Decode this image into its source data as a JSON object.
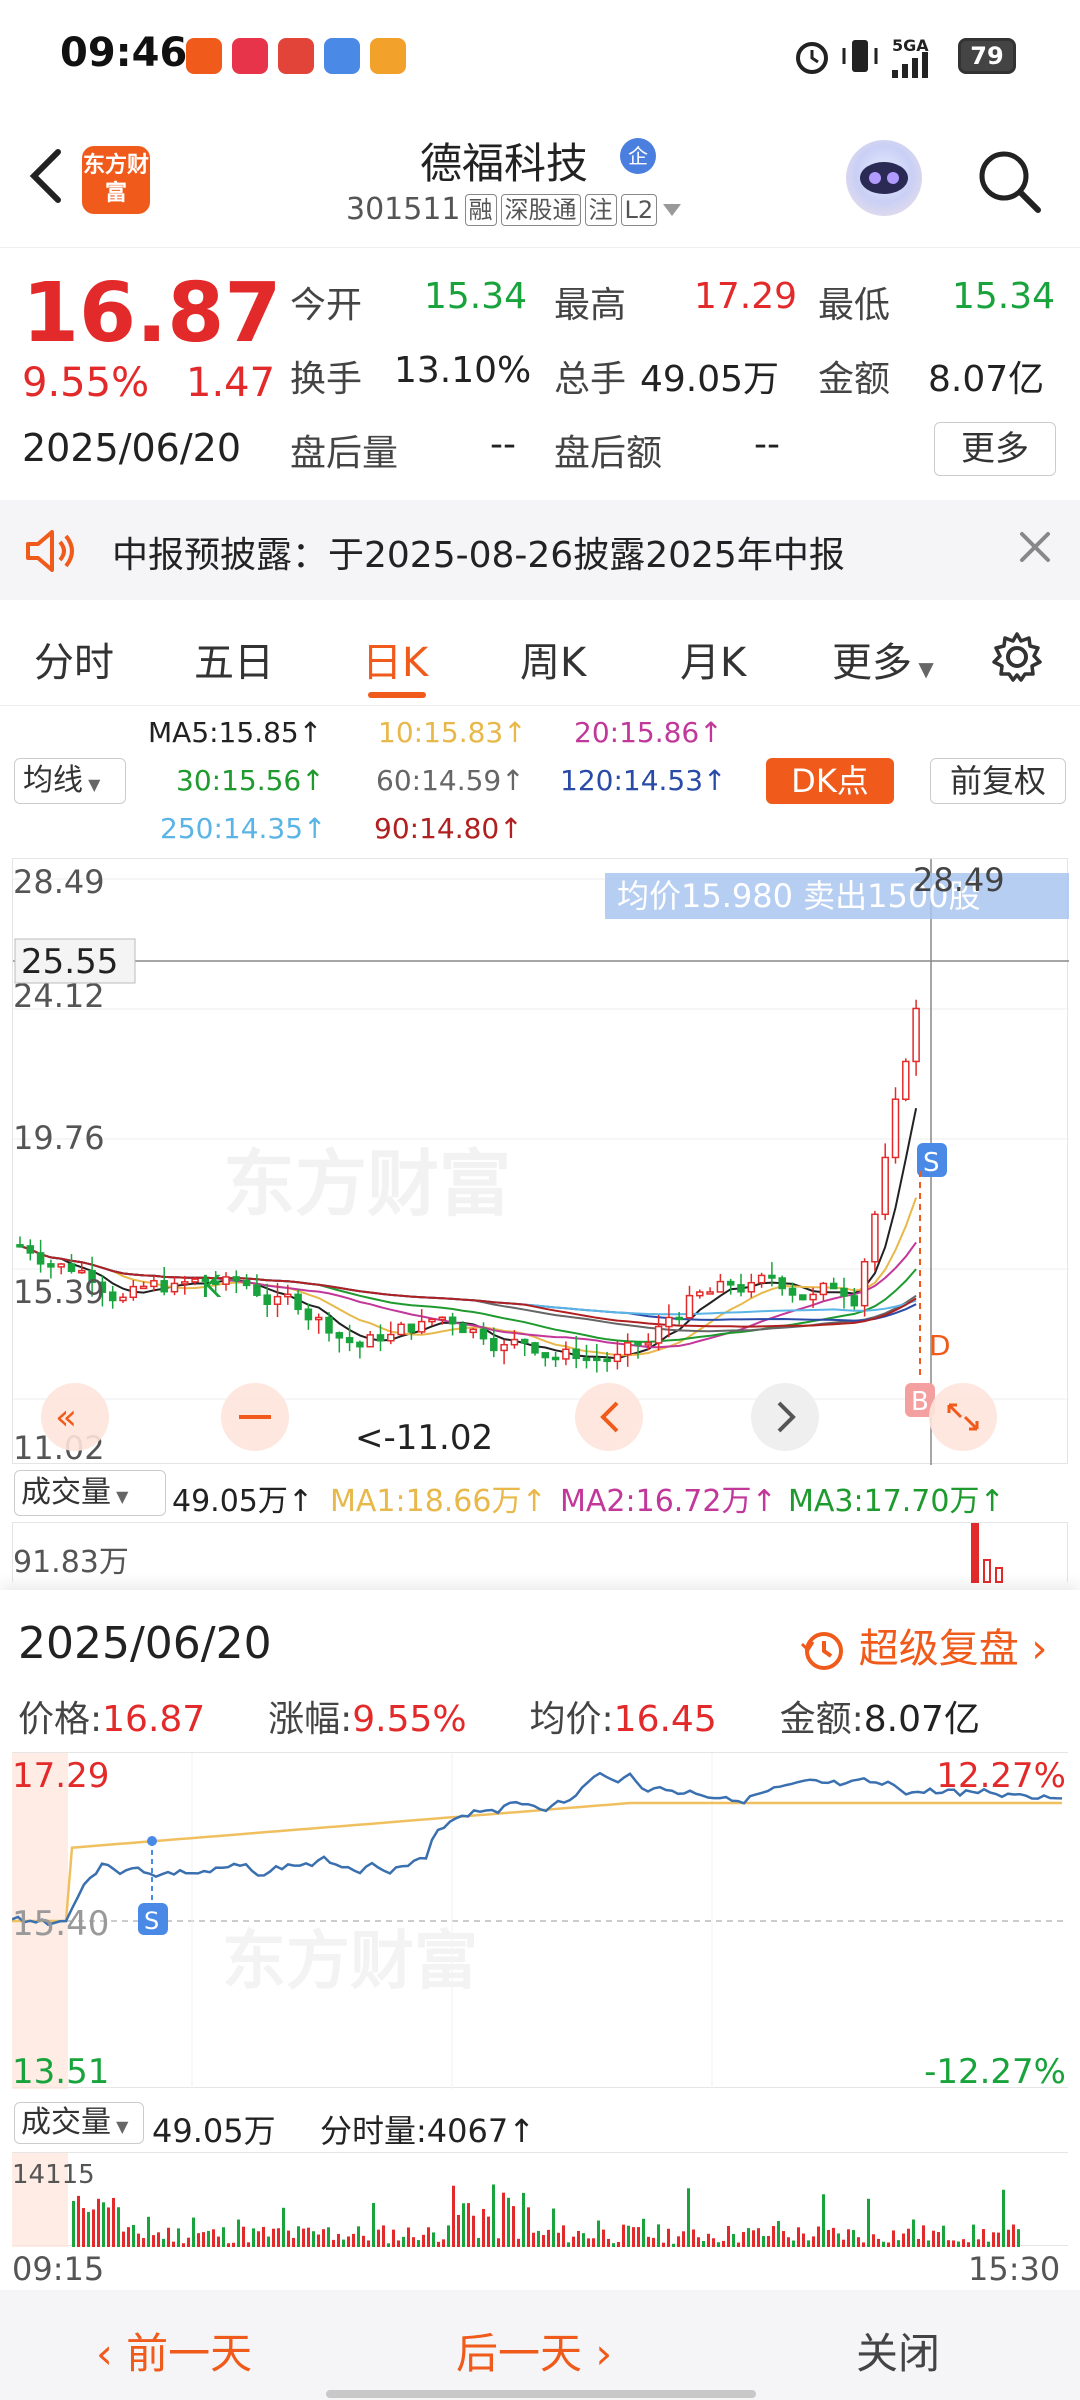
{
  "status_bar": {
    "time": "09:46",
    "network": "5GA",
    "battery": "79"
  },
  "header": {
    "stock_name": "德福科技",
    "ent_badge": "企",
    "logo_text": "东方财富",
    "stock_code": "301511",
    "tags": [
      "融",
      "深股通",
      "注",
      "L2"
    ]
  },
  "quote": {
    "price": "16.87",
    "change_pct": "9.55%",
    "change": "1.47",
    "date": "2025/06/20",
    "fields": [
      {
        "label": "今开",
        "value": "15.34",
        "color": "green"
      },
      {
        "label": "最高",
        "value": "17.29",
        "color": "red"
      },
      {
        "label": "最低",
        "value": "15.34",
        "color": "green"
      },
      {
        "label": "换手",
        "value": "13.10%",
        "color": "black"
      },
      {
        "label": "总手",
        "value": "49.05万",
        "color": "black"
      },
      {
        "label": "金额",
        "value": "8.07亿",
        "color": "black"
      },
      {
        "label": "盘后量",
        "value": "--",
        "color": "black"
      },
      {
        "label": "盘后额",
        "value": "--",
        "color": "black"
      }
    ],
    "more_label": "更多"
  },
  "notice": {
    "text": "中报预披露：于2025-08-26披露2025年中报"
  },
  "tabs": [
    "分时",
    "五日",
    "日K",
    "周K",
    "月K",
    "更多"
  ],
  "active_tab": "日K",
  "ma_legend": {
    "select_label": "均线",
    "items": [
      {
        "text": "MA5:15.85↑",
        "color": "#222222"
      },
      {
        "text": "10:15.83↑",
        "color": "#e8b84a"
      },
      {
        "text": "20:15.86↑",
        "color": "#c2379a"
      },
      {
        "text": "30:15.56↑",
        "color": "#1e9a2e"
      },
      {
        "text": "60:14.59↑",
        "color": "#666666"
      },
      {
        "text": "120:14.53↑",
        "color": "#2a4aa8"
      },
      {
        "text": "250:14.35↑",
        "color": "#5ab4e6"
      },
      {
        "text": "90:14.80↑",
        "color": "#b02020"
      }
    ],
    "dk_label": "DK点",
    "fq_label": "前复权"
  },
  "kline": {
    "y_labels": [
      "28.49",
      "24.12",
      "19.76",
      "15.39",
      "11.02"
    ],
    "crosshair_price": "25.55",
    "tooltip": "均价15.980  卖出1500股",
    "max_label": "28.49",
    "min_label": "<-11.02",
    "watermark": "东方财富",
    "k_marker": "K",
    "s_marker": "S",
    "b_marker": "B",
    "d_marker": "D"
  },
  "volume": {
    "select_label": "成交量",
    "total": "49.05万↑",
    "ma1": "MA1:18.66万↑",
    "ma2": "MA2:16.72万↑",
    "ma3": "MA3:17.70万↑",
    "y_top": "91.83万",
    "colors": {
      "ma1": "#e8b84a",
      "ma2": "#c2379a",
      "ma3": "#1e9a2e"
    }
  },
  "panel": {
    "date": "2025/06/20",
    "replay_label": "超级复盘",
    "price_label": "价格:",
    "price": "16.87",
    "pct_label": "涨幅:",
    "pct": "9.55%",
    "avg_label": "均价:",
    "avg": "16.45",
    "amt_label": "金额:",
    "amt": "8.07亿",
    "intraday": {
      "high": "17.29",
      "mid": "15.40",
      "low": "13.51",
      "up_pct": "12.27%",
      "down_pct": "-12.27%",
      "s_marker": "S"
    },
    "vol_select": "成交量",
    "vol_total": "49.05万",
    "vol_minute": "分时量:4067↑",
    "vol_top": "14115",
    "time_start": "09:15",
    "time_end": "15:30",
    "prev_day": "前一天",
    "next_day": "后一天",
    "close": "关闭"
  }
}
